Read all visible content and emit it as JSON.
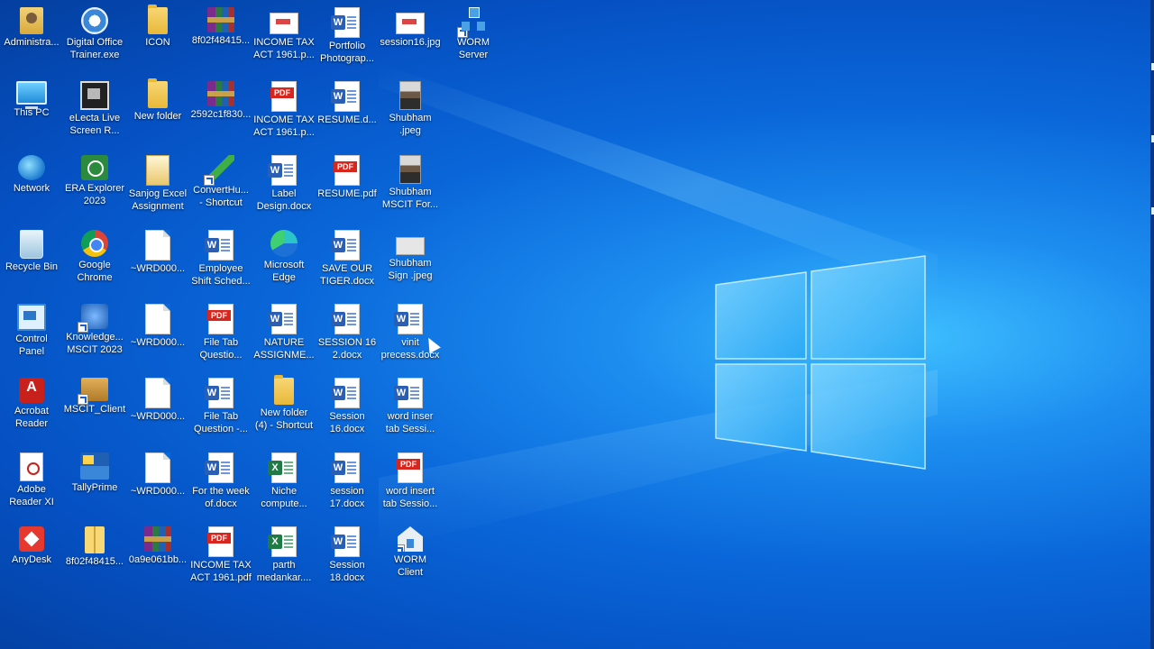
{
  "desktop": {
    "icons": [
      {
        "label": "Administra...",
        "icon": "user-folder-icon"
      },
      {
        "label": "Digital Office\nTrainer.exe",
        "icon": "digital-office-icon"
      },
      {
        "label": "ICON",
        "icon": "folder-icon"
      },
      {
        "label": "8f02f48415...",
        "icon": "winrar-archive-icon"
      },
      {
        "label": "INCOME TAX\nACT 1961.p...",
        "icon": "image-file-icon"
      },
      {
        "label": "Portfolio\nPhotograp...",
        "icon": "word-document-icon"
      },
      {
        "label": "session16.jpg",
        "icon": "image-file-icon"
      },
      {
        "label": "WORM\nServer",
        "icon": "server-shortcut-icon"
      },
      {
        "label": "This PC",
        "icon": "this-pc-icon"
      },
      {
        "label": "eLecta Live\nScreen R...",
        "icon": "video-recorder-icon"
      },
      {
        "label": "New folder",
        "icon": "folder-icon"
      },
      {
        "label": "2592c1f830...",
        "icon": "winrar-archive-icon"
      },
      {
        "label": "INCOME TAX\nACT 1961.p...",
        "icon": "pdf-document-icon"
      },
      {
        "label": "RESUME.d...",
        "icon": "word-document-icon"
      },
      {
        "label": "Shubham\n.jpeg",
        "icon": "photo-file-icon"
      },
      {
        "label": "Network",
        "icon": "network-icon"
      },
      {
        "label": "ERA Explorer\n2023",
        "icon": "era-explorer-icon"
      },
      {
        "label": "Sanjog Excel\nAssignment",
        "icon": "excel-book-icon"
      },
      {
        "label": "ConvertHu...\n- Shortcut",
        "icon": "convert-shortcut-icon"
      },
      {
        "label": "Label\nDesign.docx",
        "icon": "word-document-icon"
      },
      {
        "label": "RESUME.pdf",
        "icon": "pdf-document-icon"
      },
      {
        "label": "Shubham\nMSCIT For...",
        "icon": "photo-file-icon"
      },
      {
        "label": "Recycle Bin",
        "icon": "recycle-bin-icon"
      },
      {
        "label": "Google\nChrome",
        "icon": "chrome-icon"
      },
      {
        "label": "~WRD000...",
        "icon": "blank-document-icon"
      },
      {
        "label": "Employee\nShift Sched...",
        "icon": "word-document-icon"
      },
      {
        "label": "Microsoft\nEdge",
        "icon": "edge-icon"
      },
      {
        "label": "SAVE OUR\nTIGER.docx",
        "icon": "word-document-icon"
      },
      {
        "label": "Shubham\nSign .jpeg",
        "icon": "signature-image-icon"
      },
      {
        "label": "Control\nPanel",
        "icon": "control-panel-icon"
      },
      {
        "label": "Knowledge...\nMSCIT 2023",
        "icon": "knowledge-app-icon"
      },
      {
        "label": "~WRD000...",
        "icon": "blank-document-icon"
      },
      {
        "label": "File Tab\nQuestio...",
        "icon": "pdf-document-icon"
      },
      {
        "label": "NATURE\nASSIGNME...",
        "icon": "word-document-icon"
      },
      {
        "label": "SESSION 16\n2.docx",
        "icon": "word-document-icon"
      },
      {
        "label": "vinit\nprecess.docx",
        "icon": "word-document-icon"
      },
      {
        "label": "Acrobat\nReader",
        "icon": "acrobat-reader-icon"
      },
      {
        "label": "MSCIT_Client",
        "icon": "mscit-client-icon"
      },
      {
        "label": "~WRD000...",
        "icon": "blank-document-icon"
      },
      {
        "label": "File Tab\nQuestion -...",
        "icon": "word-document-icon"
      },
      {
        "label": "New folder\n(4) - Shortcut",
        "icon": "folder-icon"
      },
      {
        "label": "Session\n16.docx",
        "icon": "word-document-icon"
      },
      {
        "label": "word inser\ntab Sessi...",
        "icon": "word-document-icon"
      },
      {
        "label": "Adobe\nReader XI",
        "icon": "adobe-reader-icon"
      },
      {
        "label": "TallyPrime",
        "icon": "tallyprime-icon"
      },
      {
        "label": "~WRD000...",
        "icon": "blank-document-icon"
      },
      {
        "label": "For the week\nof.docx",
        "icon": "word-document-icon"
      },
      {
        "label": "Niche\ncompute...",
        "icon": "excel-document-icon"
      },
      {
        "label": "session\n17.docx",
        "icon": "word-document-icon"
      },
      {
        "label": "word insert\ntab Sessio...",
        "icon": "pdf-document-icon"
      },
      {
        "label": "AnyDesk",
        "icon": "anydesk-icon"
      },
      {
        "label": "8f02f48415...",
        "icon": "zip-folder-icon"
      },
      {
        "label": "0a9e061bb...",
        "icon": "winrar-archive-icon"
      },
      {
        "label": "INCOME TAX\nACT 1961.pdf",
        "icon": "pdf-document-icon"
      },
      {
        "label": "parth\nmedankar....",
        "icon": "excel-document-icon"
      },
      {
        "label": "Session\n18.docx",
        "icon": "word-document-icon"
      },
      {
        "label": "WORM\nClient",
        "icon": "home-client-icon"
      }
    ]
  },
  "wallpaper": {
    "accent": "#0a67d9",
    "glow": "#3fc0ff",
    "logo": "windows-logo"
  },
  "badges": {
    "word": "W",
    "excel": "X",
    "pdf": "PDF"
  }
}
